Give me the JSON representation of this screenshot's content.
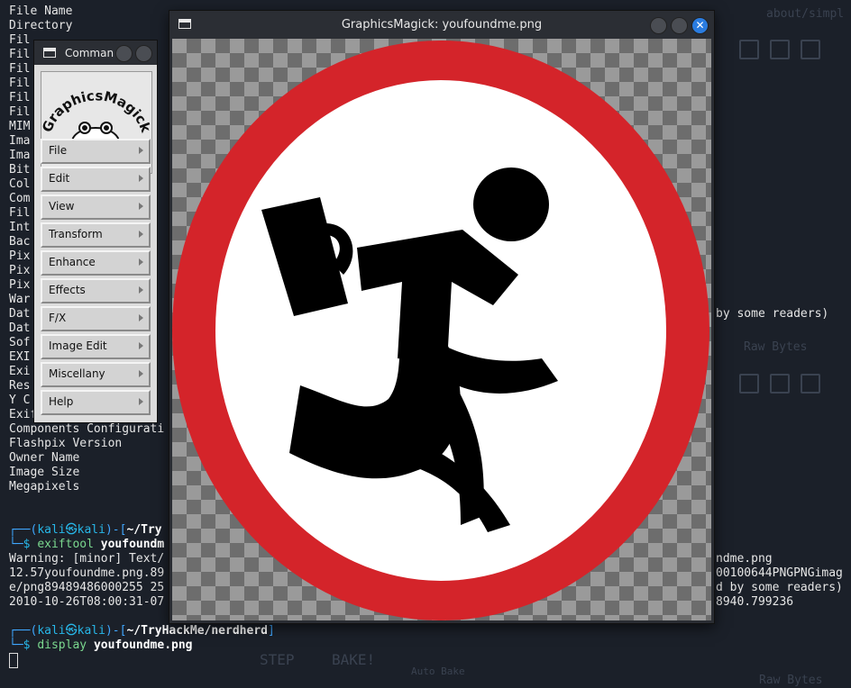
{
  "terminal": {
    "left_lines": [
      "File Name",
      "Directory",
      "Fil",
      "Fil",
      "Fil",
      "Fil",
      "Fil",
      "Fil",
      "MIM",
      "Ima",
      "Ima",
      "Bit",
      "Col",
      "Com",
      "Fil",
      "Int",
      "Bac",
      "Pix",
      "Pix",
      "Pix",
      "War",
      "Dat",
      "Dat",
      "Sof",
      "EXI",
      "Exi",
      "Res",
      "Y C",
      "Exif Version",
      "Components Configurati",
      "Flashpix Version",
      "Owner Name",
      "Image Size",
      "Megapixels"
    ],
    "right_fragment_1": "by some readers)",
    "prompt_user": "kali",
    "prompt_at": "㉿",
    "prompt_host": "kali",
    "prompt1_path": "~/Try",
    "cmd1_name": "exiftool",
    "cmd1_arg": "youfoundm",
    "out1": "Warning: [minor] Text/",
    "out1_right": "ndme.png",
    "out2": "12.57youfoundme.png.89",
    "out2_right": "00100644PNGPNGimag",
    "out3": "e/png89489486000255 25",
    "out3_right": "d by some readers)",
    "out4": "2010-10-26T08:00:31-07",
    "out4_right": "8940.799236",
    "prompt2_path": "~/TryHackMe/nerdherd",
    "cmd2_name": "display",
    "cmd2_arg": "youfoundme.png",
    "ghost_left": "STEP",
    "ghost_bake": "BAKE!",
    "ghost_autobake": "Auto Bake",
    "ghost_rawbytes": "Raw Bytes",
    "ghost_path": "about/simpl"
  },
  "image_window": {
    "title": "GraphicsMagick: youfoundme.png",
    "close_glyph": "✕"
  },
  "command_window": {
    "title": "Comman",
    "logo_text": "GraphicsMagick",
    "menu_items": [
      "File",
      "Edit",
      "View",
      "Transform",
      "Enhance",
      "Effects",
      "F/X",
      "Image Edit",
      "Miscellany",
      "Help"
    ]
  },
  "colors": {
    "sign_red": "#d4242a",
    "accent_blue": "#2a7ce0",
    "terminal_bg": "#1b2029"
  }
}
